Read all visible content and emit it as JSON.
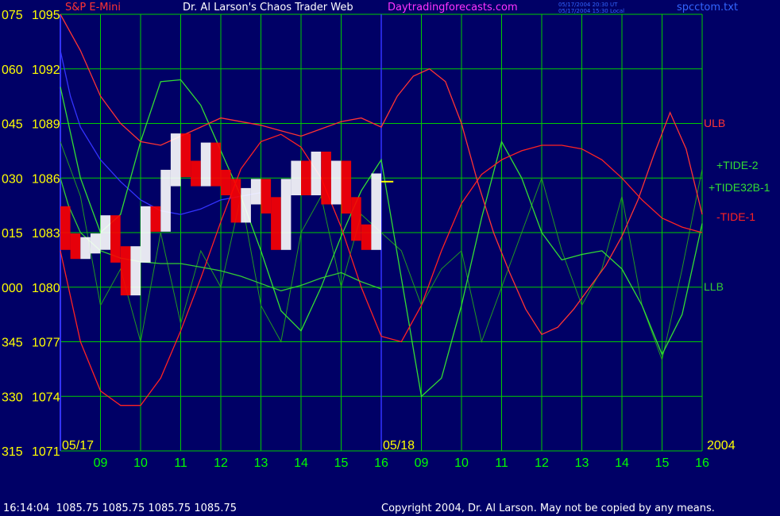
{
  "header": {
    "instrument": "S&P E-Mini",
    "site_title": "Dr. Al Larson's Chaos Trader Web",
    "site_url": "Daytradingforecasts.com",
    "stamp_ut": "05/17/2004 20:30 UT",
    "stamp_local": "05/17/2004 15:30 Local",
    "file_name": "spcctom.txt"
  },
  "footer": {
    "quote_line": "16:14:04  1085.75 1085.75 1085.75 1085.75",
    "copyright": "Copyright 2004, Dr. Al Larson. May not be copied by any means."
  },
  "colors": {
    "background": "#000066",
    "grid": "#00cc00",
    "axis_text": "#ffff00",
    "hour_text": "#00ff00",
    "price_up": "#ffffff",
    "price_down": "#ff0000",
    "ulb": "#ff3333",
    "llb": "#33cc33",
    "tide2": "#33dd33",
    "tide32b": "#229922",
    "tide1": "#ff2222",
    "blue_curve": "#3333ff",
    "divider": "#3333ff"
  },
  "chart_data": {
    "type": "line",
    "y_left_labels": [
      "075",
      "060",
      "045",
      "030",
      "015",
      "000",
      "345",
      "330",
      "315"
    ],
    "y_right_labels": [
      "1095",
      "1092",
      "1089",
      "1086",
      "1083",
      "1080",
      "1077",
      "1074",
      "1071"
    ],
    "ylim": [
      1071,
      1095
    ],
    "x_hours": [
      "09",
      "10",
      "11",
      "12",
      "13",
      "14",
      "15",
      "16",
      "09",
      "10",
      "11",
      "12",
      "13",
      "14",
      "15",
      "16"
    ],
    "date_labels": [
      "05/17",
      "05/18",
      "2004"
    ],
    "curve_labels": {
      "ulb": "ULB",
      "tide2": "+TIDE-2",
      "tide32b": "+TIDE32B-1",
      "tide1": "-TIDE-1",
      "llb": "LLB"
    },
    "series": {
      "price_close": {
        "x": [
          0,
          0.25,
          0.5,
          0.75,
          1,
          1.25,
          1.5,
          1.75,
          2,
          2.25,
          2.5,
          2.75,
          3,
          3.25,
          3.5,
          3.75,
          4,
          4.25,
          4.5,
          4.75,
          5,
          5.25,
          5.5,
          5.75,
          6,
          6.25,
          6.5,
          6.75,
          7,
          7.25,
          7.5,
          7.75,
          8
        ],
        "y": [
          1084.0,
          1082.5,
          1082.0,
          1082.3,
          1082.5,
          1083.5,
          1081.8,
          1080.0,
          1081.8,
          1084.0,
          1083.5,
          1086.0,
          1088.0,
          1086.5,
          1086.0,
          1087.5,
          1086.0,
          1085.5,
          1084.0,
          1085.0,
          1085.5,
          1084.5,
          1082.5,
          1085.5,
          1086.5,
          1085.5,
          1087.0,
          1085.0,
          1086.5,
          1084.5,
          1083.0,
          1082.5,
          1085.8
        ]
      },
      "ulb": {
        "x": [
          0,
          0.5,
          1,
          1.5,
          2,
          2.5,
          3,
          3.5,
          4,
          4.5,
          5,
          5.5,
          6,
          6.5,
          7,
          7.5,
          8,
          8.4,
          8.8,
          9.2,
          9.6,
          10,
          10.4,
          10.8,
          11.2,
          11.6,
          12,
          12.4,
          12.8,
          13.2,
          13.6,
          14,
          14.4,
          14.8,
          15.2,
          15.6,
          16
        ],
        "y": [
          1095,
          1093,
          1090.5,
          1089.0,
          1088.0,
          1087.8,
          1088.3,
          1088.8,
          1089.3,
          1089.1,
          1088.9,
          1088.6,
          1088.3,
          1088.7,
          1089.1,
          1089.3,
          1088.8,
          1090.5,
          1091.6,
          1092.0,
          1091.3,
          1089.0,
          1085.8,
          1083.0,
          1080.8,
          1078.8,
          1077.4,
          1077.8,
          1078.8,
          1080.0,
          1081.2,
          1082.8,
          1084.8,
          1087.3,
          1089.6,
          1087.6,
          1084.0
        ]
      },
      "llb": {
        "x": [
          0,
          0.2,
          0.5,
          1,
          1.5,
          2,
          2.5,
          3,
          3.5,
          4,
          4.5,
          5,
          5.5,
          6,
          6.5,
          7,
          7.5,
          8
        ],
        "y": [
          1086.0,
          1084.5,
          1083.0,
          1082.0,
          1081.6,
          1081.4,
          1081.3,
          1081.3,
          1081.1,
          1080.9,
          1080.6,
          1080.2,
          1079.8,
          1080.1,
          1080.5,
          1080.8,
          1080.3,
          1079.9
        ]
      },
      "tide2": {
        "x": [
          0,
          0.5,
          1,
          1.5,
          2,
          2.5,
          3,
          3.5,
          4,
          4.5,
          5,
          5.5,
          6,
          6.5,
          7,
          7.5,
          8,
          8.5,
          9,
          9.5,
          10,
          10.5,
          11,
          11.5,
          12,
          12.5,
          13,
          13.5,
          14,
          14.5,
          15,
          15.5,
          16
        ],
        "y": [
          1091.0,
          1086.0,
          1083.0,
          1084.0,
          1088.0,
          1091.3,
          1091.4,
          1090.0,
          1087.5,
          1085.0,
          1082.0,
          1078.7,
          1077.6,
          1080.0,
          1082.8,
          1085.3,
          1087.0,
          1080.5,
          1074.0,
          1075.0,
          1079.0,
          1083.8,
          1088.0,
          1086.0,
          1083.0,
          1081.5,
          1081.8,
          1082.0,
          1081.0,
          1079.0,
          1076.3,
          1078.5,
          1083.5
        ]
      },
      "tide32b": {
        "x": [
          0,
          0.5,
          1,
          1.5,
          2,
          2.5,
          3,
          3.5,
          4,
          4.5,
          5,
          5.5,
          6,
          6.5,
          7,
          7.5,
          8,
          8.5,
          9,
          9.5,
          10,
          10.5,
          11,
          11.5,
          12,
          12.5,
          13,
          13.5,
          14,
          14.5,
          15,
          15.5,
          16
        ],
        "y": [
          1088.0,
          1085.0,
          1079.0,
          1081.0,
          1077.0,
          1083.0,
          1078.0,
          1082.0,
          1080.0,
          1085.0,
          1079.0,
          1077.0,
          1083.0,
          1085.0,
          1080.0,
          1084.0,
          1083.0,
          1082.0,
          1079.0,
          1081.0,
          1082.0,
          1077.0,
          1080.0,
          1083.0,
          1086.0,
          1082.0,
          1079.0,
          1081.0,
          1085.0,
          1079.0,
          1076.0,
          1081.0,
          1086.5
        ]
      },
      "tide1": {
        "x": [
          0,
          0.5,
          1,
          1.5,
          2,
          2.5,
          3,
          3.5,
          4,
          4.5,
          5,
          5.5,
          6,
          6.5,
          7,
          7.5,
          8,
          8.5,
          9,
          9.5,
          10,
          10.5,
          11,
          11.5,
          12,
          12.5,
          13,
          13.5,
          14,
          14.5,
          15,
          15.5,
          16
        ],
        "y": [
          1082.0,
          1077.0,
          1074.3,
          1073.5,
          1073.5,
          1075.0,
          1077.6,
          1080.5,
          1083.6,
          1086.5,
          1088.0,
          1088.4,
          1087.7,
          1086.0,
          1083.3,
          1080.0,
          1077.3,
          1077.0,
          1079.0,
          1082.0,
          1084.6,
          1086.2,
          1087.0,
          1087.5,
          1087.8,
          1087.8,
          1087.6,
          1087.0,
          1086.0,
          1084.8,
          1083.8,
          1083.3,
          1083.0
        ]
      },
      "blue_curve": {
        "x": [
          0,
          0.25,
          0.5,
          1,
          1.5,
          2,
          2.5,
          3,
          3.5,
          4,
          4.5,
          5
        ],
        "y": [
          1093.0,
          1090.5,
          1088.8,
          1087.0,
          1085.8,
          1084.8,
          1084.2,
          1084.0,
          1084.3,
          1084.8,
          1085.0,
          1085.2
        ]
      },
      "forecast_mark": {
        "x": [
          8,
          8.3
        ],
        "y": [
          1085.8,
          1085.8
        ]
      }
    }
  }
}
